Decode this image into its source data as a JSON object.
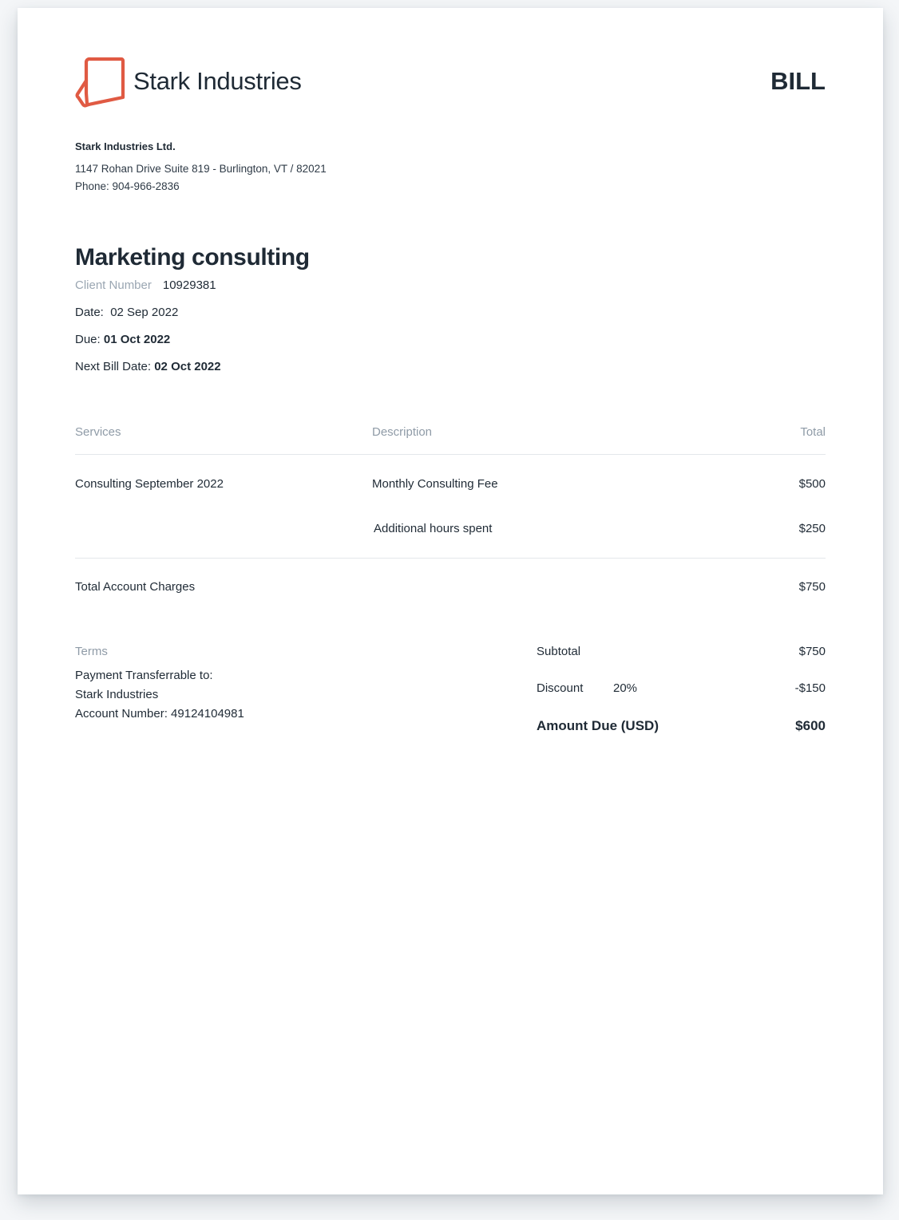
{
  "header": {
    "brand_name": "Stark Industries",
    "document_type": "BILL",
    "logo_icon": "folded-document-logo",
    "accent_color": "#e05a43"
  },
  "company": {
    "name": "Stark Industries Ltd.",
    "address": "1147 Rohan Drive Suite 819 - Burlington, VT / 82021",
    "phone": "Phone: 904-966-2836"
  },
  "bill": {
    "title": "Marketing consulting",
    "client_number_label": "Client Number",
    "client_number": "10929381",
    "date_label": "Date:",
    "date": "02 Sep 2022",
    "due_label": "Due:",
    "due": "01 Oct 2022",
    "next_bill_label": "Next Bill Date:",
    "next_bill": "02 Oct 2022"
  },
  "table": {
    "headers": {
      "services": "Services",
      "description": "Description",
      "total": "Total"
    },
    "rows": [
      {
        "service": "Consulting September 2022",
        "description": "Monthly Consulting Fee",
        "total": "$500"
      },
      {
        "service": "",
        "description": "Additional hours spent",
        "total": "$250"
      }
    ],
    "total_label": "Total Account Charges",
    "total_value": "$750"
  },
  "terms": {
    "label": "Terms",
    "lines": [
      "Payment Transferrable to:",
      "Stark Industries",
      "Account Number: 49124104981"
    ]
  },
  "summary": {
    "subtotal_label": "Subtotal",
    "subtotal_value": "$750",
    "discount_label": "Discount",
    "discount_rate": "20%",
    "discount_value": "-$150",
    "amount_due_label": "Amount Due (USD)",
    "amount_due_value": "$600"
  }
}
